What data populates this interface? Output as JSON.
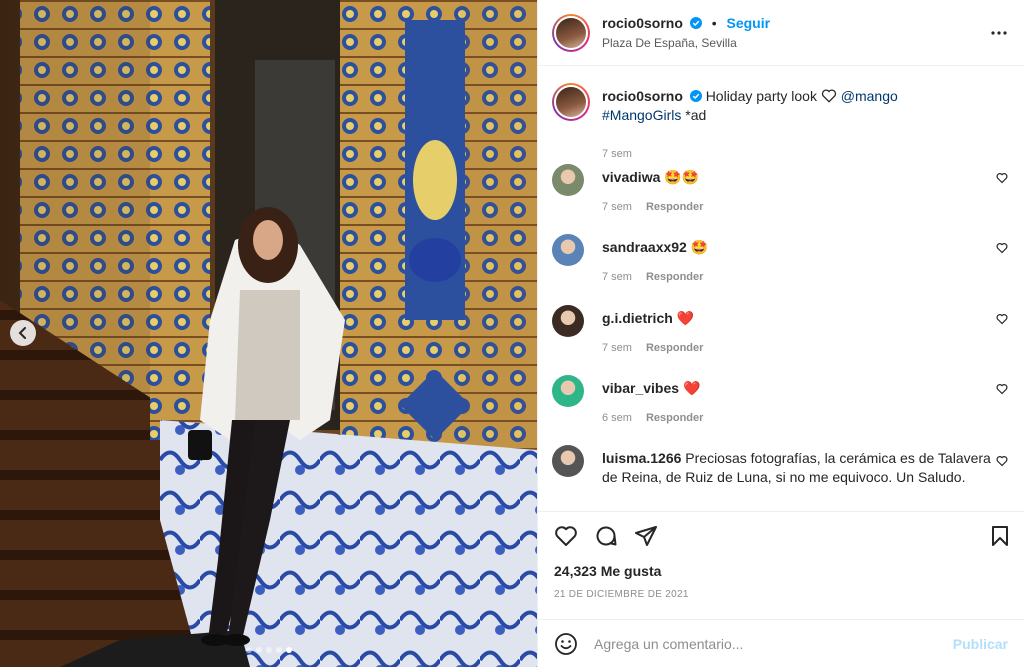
{
  "post": {
    "username": "rocio0sorno",
    "follow_label": "Seguir",
    "bullet": "•",
    "location": "Plaza De España, Sevilla",
    "more_icon": "more-horizontal-icon",
    "carousel": {
      "slide_count": 5,
      "active_index": 4
    }
  },
  "caption": {
    "username": "rocio0sorno",
    "text": "Holiday party look",
    "mention": "@mango",
    "hashtag": "#MangoGirls",
    "suffix": "*ad",
    "time": "7 sem"
  },
  "comments": [
    {
      "user": "vivadiwa",
      "text": "🤩🤩",
      "time": "7 sem",
      "reply": "Responder",
      "avatar_color": "#7a8a6a"
    },
    {
      "user": "sandraaxx92",
      "text": "🤩",
      "time": "7 sem",
      "reply": "Responder",
      "avatar_color": "#5a84b8"
    },
    {
      "user": "g.i.dietrich",
      "text": "❤️",
      "time": "7 sem",
      "reply": "Responder",
      "avatar_color": "#3b2b22"
    },
    {
      "user": "vibar_vibes",
      "text": "❤️",
      "time": "6 sem",
      "reply": "Responder",
      "avatar_color": "#2eb58a"
    },
    {
      "user": "luisma.1266",
      "text": "Preciosas fotografías, la cerámica es de Talavera de Reina, de Ruiz de Luna, si no me equivoco. Un Saludo.",
      "time": "",
      "reply": "",
      "avatar_color": "#555555"
    }
  ],
  "stats": {
    "likes": "24,323 Me gusta",
    "date": "21 DE DICIEMBRE DE 2021"
  },
  "composer": {
    "placeholder": "Agrega un comentario...",
    "publish_label": "Publicar"
  },
  "colors": {
    "accent": "#0095f6",
    "link": "#00376b",
    "muted": "#8e8e8e",
    "publish_disabled": "#b2dffc",
    "heart_red": "#ed4956"
  }
}
